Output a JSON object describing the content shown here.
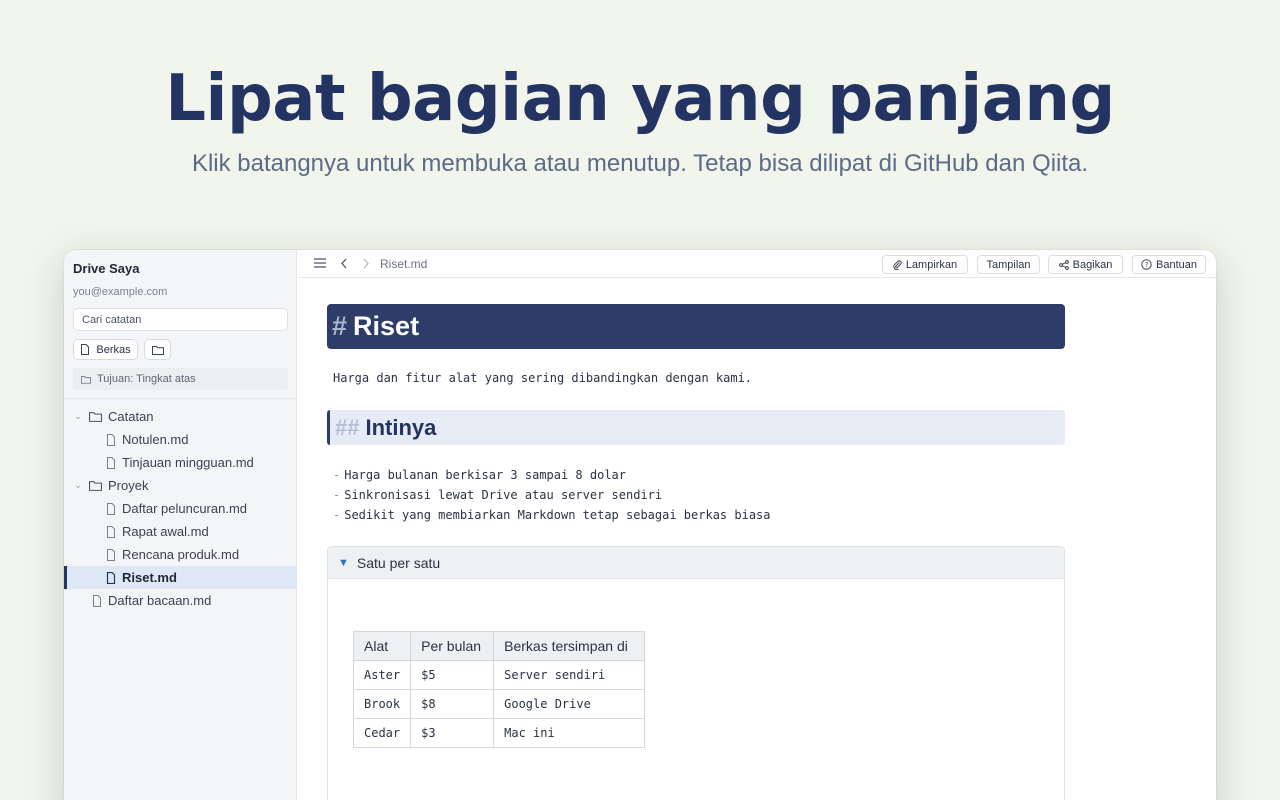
{
  "hero": {
    "title": "Lipat bagian yang panjang",
    "subtitle": "Klik batangnya untuk membuka atau menutup. Tetap bisa dilipat di GitHub dan Qiita."
  },
  "sidebar": {
    "title": "Drive Saya",
    "email": "you@example.com",
    "search_placeholder": "Cari catatan",
    "file_button": "Berkas",
    "target": "Tujuan: Tingkat atas",
    "tree": [
      {
        "label": "Catatan",
        "type": "folder"
      },
      {
        "label": "Notulen.md",
        "type": "file"
      },
      {
        "label": "Tinjauan mingguan.md",
        "type": "file"
      },
      {
        "label": "Proyek",
        "type": "folder"
      },
      {
        "label": "Daftar peluncuran.md",
        "type": "file"
      },
      {
        "label": "Rapat awal.md",
        "type": "file"
      },
      {
        "label": "Rencana produk.md",
        "type": "file"
      },
      {
        "label": "Riset.md",
        "type": "file",
        "active": true
      },
      {
        "label": "Daftar bacaan.md",
        "type": "file"
      }
    ]
  },
  "topbar": {
    "path": "Riset.md",
    "attach": "Lampirkan",
    "view": "Tampilan",
    "share": "Bagikan",
    "help": "Bantuan"
  },
  "doc": {
    "h1_hash": "#",
    "h1": "Riset",
    "intro": "Harga dan fitur alat yang sering dibandingkan dengan kami.",
    "h2_hash": "##",
    "h2": "Intinya",
    "bullets": [
      "Harga bulanan berkisar 3 sampai 8 dolar",
      "Sinkronisasi lewat Drive atau server sendiri",
      "Sedikit yang membiarkan Markdown tetap sebagai berkas biasa"
    ],
    "details_summary": "Satu per satu",
    "table": {
      "headers": [
        "Alat",
        "Per bulan",
        "Berkas tersimpan di"
      ],
      "rows": [
        [
          "Aster",
          "$5",
          "Server sendiri"
        ],
        [
          "Brook",
          "$8",
          "Google Drive"
        ],
        [
          "Cedar",
          "$3",
          "Mac ini"
        ]
      ]
    }
  },
  "colors": {
    "accent": "#24345f",
    "background": "#f1f5ec",
    "active_row": "#dde7f6"
  }
}
